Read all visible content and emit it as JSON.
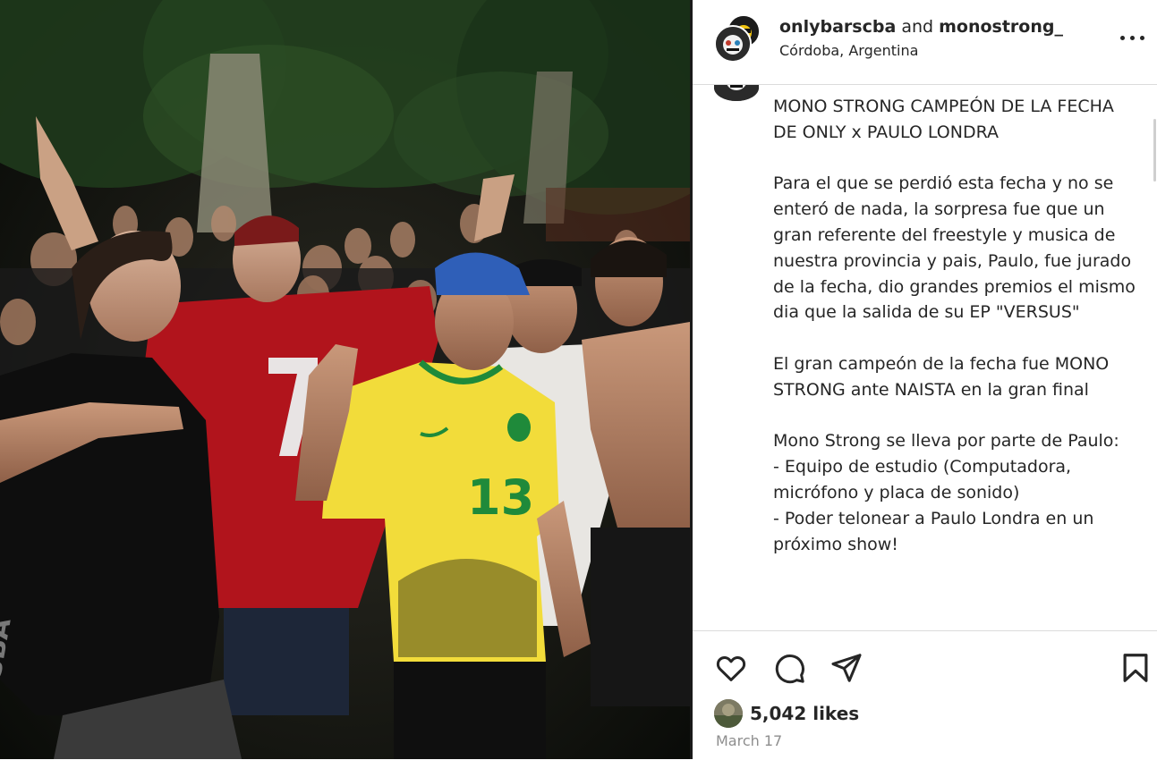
{
  "header": {
    "user1": "onlybarscba",
    "joiner": "and",
    "user2": "monostrong_",
    "location": "Córdoba, Argentina",
    "more_icon": "more-horizontal-icon"
  },
  "caption": {
    "text": "MONO STRONG CAMPEÓN DE LA FECHA DE ONLY x PAULO LONDRA\n\nPara el que se perdió esta fecha y no se enteró de nada, la sorpresa fue que un gran referente del freestyle y musica de nuestra provincia y pais, Paulo, fue jurado de la fecha, dio grandes premios el mismo dia que la salida de su EP \"VERSUS\"\n\nEl gran campeón de la fecha fue MONO STRONG ante NAISTA en la gran final\n\nMono Strong se lleva por parte de Paulo:\n- Equipo de estudio (Computadora, micrófono y placa de sonido)\n- Poder telonear a Paulo Londra en un próximo show!"
  },
  "photo": {
    "jersey_numbers": [
      "7",
      "13"
    ]
  },
  "actions": {
    "icons": [
      "heart-icon",
      "comment-icon",
      "share-icon",
      "bookmark-icon"
    ]
  },
  "stats": {
    "likes": "5,042 likes",
    "date": "March 17"
  },
  "colors": {
    "text": "#262626",
    "muted": "#8e8e8e",
    "border": "#dbdbdb",
    "jersey_yellow": "#f2dc3a",
    "jersey_red": "#b1141c"
  }
}
